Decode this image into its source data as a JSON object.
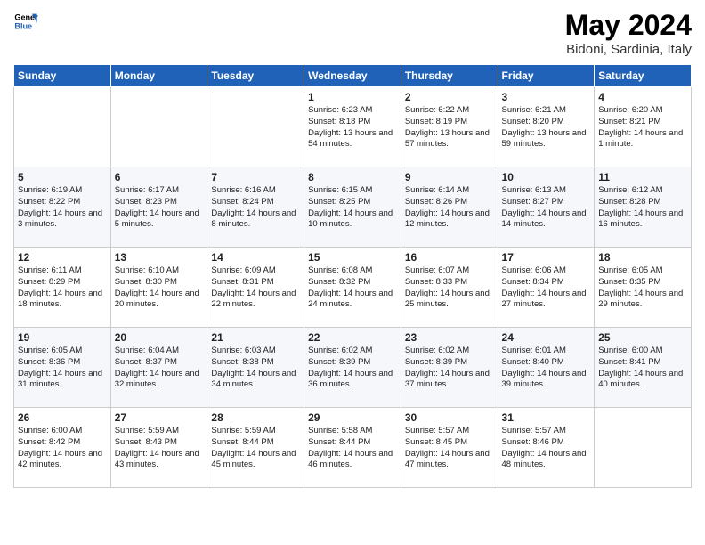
{
  "header": {
    "logo_line1": "General",
    "logo_line2": "Blue",
    "title": "May 2024",
    "subtitle": "Bidoni, Sardinia, Italy"
  },
  "weekdays": [
    "Sunday",
    "Monday",
    "Tuesday",
    "Wednesday",
    "Thursday",
    "Friday",
    "Saturday"
  ],
  "rows": [
    [
      {
        "day": "",
        "sunrise": "",
        "sunset": "",
        "daylight": ""
      },
      {
        "day": "",
        "sunrise": "",
        "sunset": "",
        "daylight": ""
      },
      {
        "day": "",
        "sunrise": "",
        "sunset": "",
        "daylight": ""
      },
      {
        "day": "1",
        "sunrise": "Sunrise: 6:23 AM",
        "sunset": "Sunset: 8:18 PM",
        "daylight": "Daylight: 13 hours and 54 minutes."
      },
      {
        "day": "2",
        "sunrise": "Sunrise: 6:22 AM",
        "sunset": "Sunset: 8:19 PM",
        "daylight": "Daylight: 13 hours and 57 minutes."
      },
      {
        "day": "3",
        "sunrise": "Sunrise: 6:21 AM",
        "sunset": "Sunset: 8:20 PM",
        "daylight": "Daylight: 13 hours and 59 minutes."
      },
      {
        "day": "4",
        "sunrise": "Sunrise: 6:20 AM",
        "sunset": "Sunset: 8:21 PM",
        "daylight": "Daylight: 14 hours and 1 minute."
      }
    ],
    [
      {
        "day": "5",
        "sunrise": "Sunrise: 6:19 AM",
        "sunset": "Sunset: 8:22 PM",
        "daylight": "Daylight: 14 hours and 3 minutes."
      },
      {
        "day": "6",
        "sunrise": "Sunrise: 6:17 AM",
        "sunset": "Sunset: 8:23 PM",
        "daylight": "Daylight: 14 hours and 5 minutes."
      },
      {
        "day": "7",
        "sunrise": "Sunrise: 6:16 AM",
        "sunset": "Sunset: 8:24 PM",
        "daylight": "Daylight: 14 hours and 8 minutes."
      },
      {
        "day": "8",
        "sunrise": "Sunrise: 6:15 AM",
        "sunset": "Sunset: 8:25 PM",
        "daylight": "Daylight: 14 hours and 10 minutes."
      },
      {
        "day": "9",
        "sunrise": "Sunrise: 6:14 AM",
        "sunset": "Sunset: 8:26 PM",
        "daylight": "Daylight: 14 hours and 12 minutes."
      },
      {
        "day": "10",
        "sunrise": "Sunrise: 6:13 AM",
        "sunset": "Sunset: 8:27 PM",
        "daylight": "Daylight: 14 hours and 14 minutes."
      },
      {
        "day": "11",
        "sunrise": "Sunrise: 6:12 AM",
        "sunset": "Sunset: 8:28 PM",
        "daylight": "Daylight: 14 hours and 16 minutes."
      }
    ],
    [
      {
        "day": "12",
        "sunrise": "Sunrise: 6:11 AM",
        "sunset": "Sunset: 8:29 PM",
        "daylight": "Daylight: 14 hours and 18 minutes."
      },
      {
        "day": "13",
        "sunrise": "Sunrise: 6:10 AM",
        "sunset": "Sunset: 8:30 PM",
        "daylight": "Daylight: 14 hours and 20 minutes."
      },
      {
        "day": "14",
        "sunrise": "Sunrise: 6:09 AM",
        "sunset": "Sunset: 8:31 PM",
        "daylight": "Daylight: 14 hours and 22 minutes."
      },
      {
        "day": "15",
        "sunrise": "Sunrise: 6:08 AM",
        "sunset": "Sunset: 8:32 PM",
        "daylight": "Daylight: 14 hours and 24 minutes."
      },
      {
        "day": "16",
        "sunrise": "Sunrise: 6:07 AM",
        "sunset": "Sunset: 8:33 PM",
        "daylight": "Daylight: 14 hours and 25 minutes."
      },
      {
        "day": "17",
        "sunrise": "Sunrise: 6:06 AM",
        "sunset": "Sunset: 8:34 PM",
        "daylight": "Daylight: 14 hours and 27 minutes."
      },
      {
        "day": "18",
        "sunrise": "Sunrise: 6:05 AM",
        "sunset": "Sunset: 8:35 PM",
        "daylight": "Daylight: 14 hours and 29 minutes."
      }
    ],
    [
      {
        "day": "19",
        "sunrise": "Sunrise: 6:05 AM",
        "sunset": "Sunset: 8:36 PM",
        "daylight": "Daylight: 14 hours and 31 minutes."
      },
      {
        "day": "20",
        "sunrise": "Sunrise: 6:04 AM",
        "sunset": "Sunset: 8:37 PM",
        "daylight": "Daylight: 14 hours and 32 minutes."
      },
      {
        "day": "21",
        "sunrise": "Sunrise: 6:03 AM",
        "sunset": "Sunset: 8:38 PM",
        "daylight": "Daylight: 14 hours and 34 minutes."
      },
      {
        "day": "22",
        "sunrise": "Sunrise: 6:02 AM",
        "sunset": "Sunset: 8:39 PM",
        "daylight": "Daylight: 14 hours and 36 minutes."
      },
      {
        "day": "23",
        "sunrise": "Sunrise: 6:02 AM",
        "sunset": "Sunset: 8:39 PM",
        "daylight": "Daylight: 14 hours and 37 minutes."
      },
      {
        "day": "24",
        "sunrise": "Sunrise: 6:01 AM",
        "sunset": "Sunset: 8:40 PM",
        "daylight": "Daylight: 14 hours and 39 minutes."
      },
      {
        "day": "25",
        "sunrise": "Sunrise: 6:00 AM",
        "sunset": "Sunset: 8:41 PM",
        "daylight": "Daylight: 14 hours and 40 minutes."
      }
    ],
    [
      {
        "day": "26",
        "sunrise": "Sunrise: 6:00 AM",
        "sunset": "Sunset: 8:42 PM",
        "daylight": "Daylight: 14 hours and 42 minutes."
      },
      {
        "day": "27",
        "sunrise": "Sunrise: 5:59 AM",
        "sunset": "Sunset: 8:43 PM",
        "daylight": "Daylight: 14 hours and 43 minutes."
      },
      {
        "day": "28",
        "sunrise": "Sunrise: 5:59 AM",
        "sunset": "Sunset: 8:44 PM",
        "daylight": "Daylight: 14 hours and 45 minutes."
      },
      {
        "day": "29",
        "sunrise": "Sunrise: 5:58 AM",
        "sunset": "Sunset: 8:44 PM",
        "daylight": "Daylight: 14 hours and 46 minutes."
      },
      {
        "day": "30",
        "sunrise": "Sunrise: 5:57 AM",
        "sunset": "Sunset: 8:45 PM",
        "daylight": "Daylight: 14 hours and 47 minutes."
      },
      {
        "day": "31",
        "sunrise": "Sunrise: 5:57 AM",
        "sunset": "Sunset: 8:46 PM",
        "daylight": "Daylight: 14 hours and 48 minutes."
      },
      {
        "day": "",
        "sunrise": "",
        "sunset": "",
        "daylight": ""
      }
    ]
  ]
}
